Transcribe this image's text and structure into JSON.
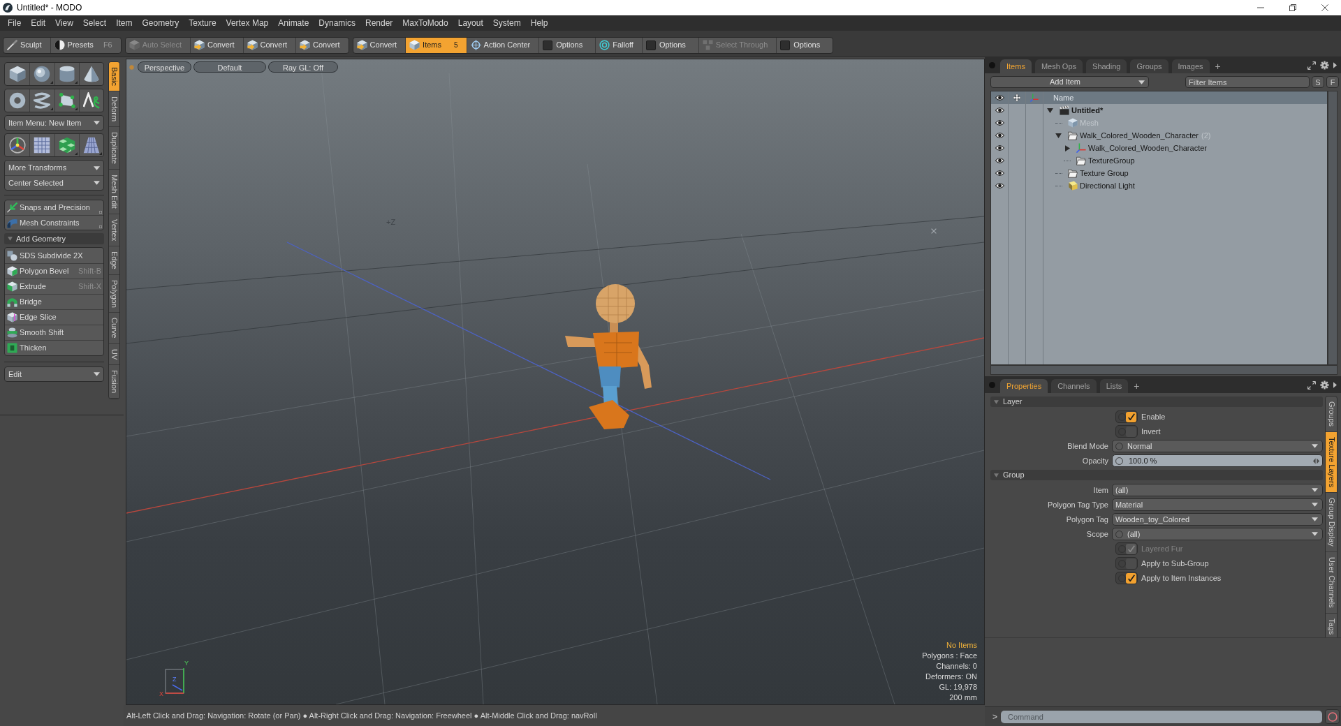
{
  "window": {
    "title": "Untitled* - MODO"
  },
  "menu_bar": [
    "File",
    "Edit",
    "View",
    "Select",
    "Item",
    "Geometry",
    "Texture",
    "Vertex Map",
    "Animate",
    "Dynamics",
    "Render",
    "MaxToModo",
    "Layout",
    "System",
    "Help"
  ],
  "toolbar": [
    [
      {
        "kind": "tool",
        "label": "Sculpt",
        "selected": false,
        "disabled": false
      },
      {
        "kind": "tool",
        "label": "Presets",
        "shortcut": "F6",
        "selected": false,
        "disabled": false
      }
    ],
    [
      {
        "kind": "tool",
        "label": "Auto Select",
        "selected": false,
        "disabled": true
      },
      {
        "kind": "tool",
        "label": "Convert",
        "selected": false,
        "disabled": false
      },
      {
        "kind": "tool",
        "label": "Convert",
        "selected": false,
        "disabled": false
      },
      {
        "kind": "tool",
        "label": "Convert",
        "selected": false,
        "disabled": false
      }
    ],
    [
      {
        "kind": "tool",
        "label": "Convert",
        "selected": false,
        "disabled": false
      },
      {
        "kind": "tool",
        "label": "Items",
        "badge": "5",
        "selected": true,
        "disabled": false
      },
      {
        "kind": "tool",
        "label": "Action Center",
        "selected": false,
        "disabled": false
      },
      {
        "kind": "option",
        "label": "Options",
        "checked": false
      },
      {
        "kind": "tool",
        "label": "Falloff",
        "selected": false,
        "disabled": false
      },
      {
        "kind": "option",
        "label": "Options",
        "checked": false
      },
      {
        "kind": "tool",
        "label": "Select Through",
        "selected": false,
        "disabled": true
      },
      {
        "kind": "option",
        "label": "Options",
        "checked": false
      }
    ]
  ],
  "tool_palette": {
    "item_menu": "Item Menu: New Item",
    "transform_menus": [
      "More Transforms",
      "Center Selected"
    ],
    "precision_buttons": [
      "Snaps and Precision",
      "Mesh Constraints"
    ],
    "section": {
      "title": "Add Geometry",
      "expanded": true,
      "tools": [
        {
          "label": "SDS Subdivide 2X"
        },
        {
          "label": "Polygon Bevel",
          "shortcut": "Shift-B"
        },
        {
          "label": "Extrude",
          "shortcut": "Shift-X"
        },
        {
          "label": "Bridge"
        },
        {
          "label": "Edge Slice"
        },
        {
          "label": "Smooth Shift"
        },
        {
          "label": "Thicken"
        }
      ]
    },
    "edit_menu": "Edit",
    "tabs": [
      {
        "label": "Basic",
        "selected": true
      },
      {
        "label": "Deform",
        "selected": false
      },
      {
        "label": "Duplicate",
        "selected": false
      },
      {
        "label": "Mesh Edit",
        "selected": false
      },
      {
        "label": "Vertex",
        "selected": false
      },
      {
        "label": "Edge",
        "selected": false
      },
      {
        "label": "Polygon",
        "selected": false
      },
      {
        "label": "Curve",
        "selected": false
      },
      {
        "label": "UV",
        "selected": false
      },
      {
        "label": "Fusion",
        "selected": false
      }
    ]
  },
  "viewport": {
    "header": [
      "Perspective",
      "Default",
      "Ray GL: Off"
    ],
    "axis_label": "+Z",
    "gizmo_labels": [
      "Y",
      "Z",
      "X"
    ],
    "info": {
      "selection": "No Items",
      "lines": [
        "Polygons : Face",
        "Channels: 0",
        "Deformers: ON",
        "GL: 19,978",
        "200 mm"
      ]
    }
  },
  "status_bar": "Alt-Left Click and Drag: Navigation: Rotate (or Pan) ● Alt-Right Click and Drag: Navigation: Freewheel ● Alt-Middle Click and Drag: navRoll",
  "items_panel": {
    "tabs": [
      {
        "label": "Items",
        "selected": true
      },
      {
        "label": "Mesh Ops",
        "selected": false
      },
      {
        "label": "Shading",
        "selected": false
      },
      {
        "label": "Groups",
        "selected": false
      },
      {
        "label": "Images",
        "selected": false
      }
    ],
    "add_tab": "+",
    "add_item": "Add Item",
    "filter": {
      "placeholder": "Filter Items"
    },
    "filter_buttons": [
      "S",
      "F"
    ],
    "name_column": "Name",
    "tree": [
      {
        "name": "Untitled*",
        "kind": "scene",
        "visible": true,
        "dimmed": false,
        "expanded": true,
        "children": [
          {
            "name": "Mesh",
            "kind": "mesh",
            "visible": true,
            "dimmed": true
          },
          {
            "name": "Walk_Colored_Wooden_Character",
            "count": "(2)",
            "kind": "group",
            "visible": true,
            "dimmed": false,
            "expanded": true,
            "children": [
              {
                "name": "Walk_Colored_Wooden_Character",
                "kind": "locator",
                "visible": true,
                "dimmed": false,
                "expanded": false
              },
              {
                "name": "TextureGroup",
                "kind": "group",
                "visible": true,
                "dimmed": false
              }
            ]
          },
          {
            "name": "Texture Group",
            "kind": "group",
            "visible": true,
            "dimmed": false
          },
          {
            "name": "Directional Light",
            "kind": "light",
            "visible": true,
            "dimmed": false
          }
        ]
      }
    ]
  },
  "properties_panel": {
    "tabs": [
      {
        "label": "Properties",
        "selected": true
      },
      {
        "label": "Channels",
        "selected": false
      },
      {
        "label": "Lists",
        "selected": false
      }
    ],
    "add_tab": "+",
    "sections": [
      {
        "title": "Layer",
        "expanded": true,
        "rows": [
          {
            "kind": "checkbox",
            "label": "Enable",
            "checked": true,
            "disabled": false,
            "animatable": true
          },
          {
            "kind": "checkbox",
            "label": "Invert",
            "checked": false,
            "disabled": false,
            "animatable": true
          },
          {
            "kind": "dropdown",
            "label": "Blend Mode",
            "value": "Normal",
            "animatable": true
          },
          {
            "kind": "number",
            "label": "Opacity",
            "value": "100.0 %",
            "animatable": true
          }
        ]
      },
      {
        "title": "Group",
        "expanded": true,
        "rows": [
          {
            "kind": "dropdown",
            "label": "Item",
            "value": "(all)",
            "animatable": false
          },
          {
            "kind": "dropdown",
            "label": "Polygon Tag Type",
            "value": "Material",
            "animatable": false
          },
          {
            "kind": "dropdown",
            "label": "Polygon Tag",
            "value": "Wooden_toy_Colored",
            "animatable": false
          },
          {
            "kind": "dropdown",
            "label": "Scope",
            "value": "(all)",
            "animatable": true
          },
          {
            "kind": "checkbox",
            "label": "Layered Fur",
            "checked": true,
            "disabled": true,
            "animatable": true
          },
          {
            "kind": "checkbox",
            "label": "Apply to Sub-Group",
            "checked": false,
            "disabled": false,
            "animatable": true
          },
          {
            "kind": "checkbox",
            "label": "Apply to Item Instances",
            "checked": true,
            "disabled": false,
            "animatable": true
          }
        ]
      }
    ],
    "side_tabs": [
      {
        "label": "Groups",
        "selected": false
      },
      {
        "label": "Texture Layers",
        "selected": true
      },
      {
        "label": "Group Display",
        "selected": false
      },
      {
        "label": "User Channels",
        "selected": false
      },
      {
        "label": "Tags",
        "selected": false
      }
    ]
  },
  "command_bar": {
    "prompt": ">",
    "placeholder": "Command"
  }
}
